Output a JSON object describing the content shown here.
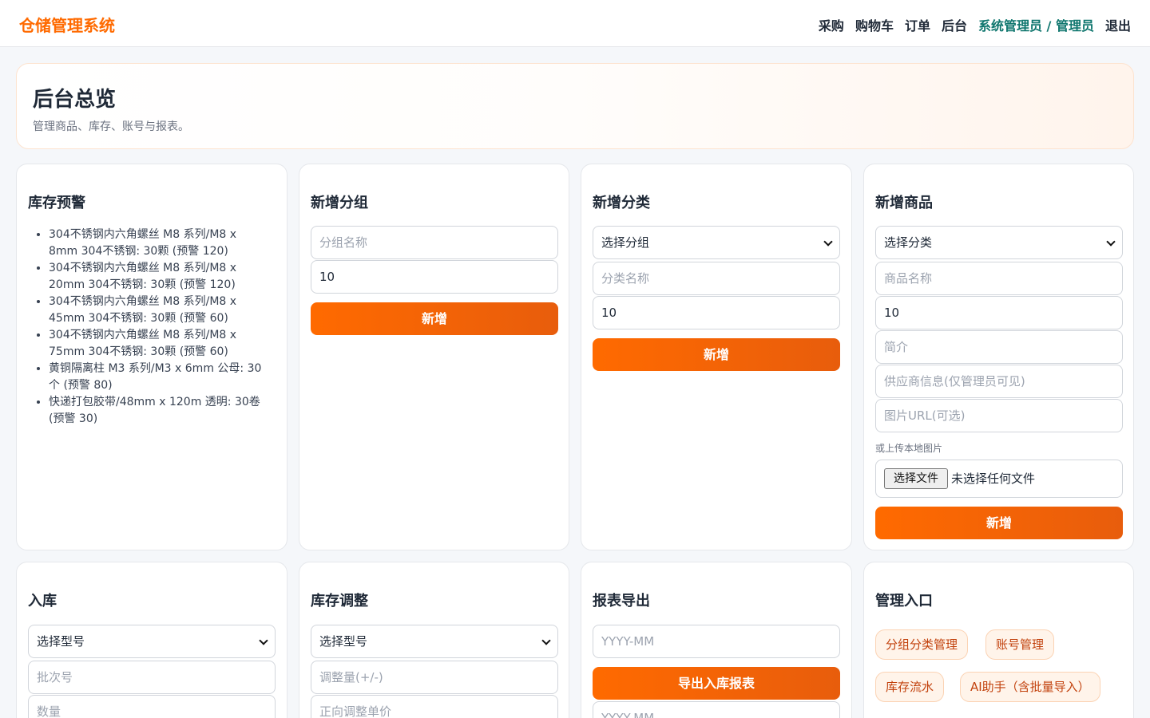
{
  "app": {
    "title": "仓储管理系统"
  },
  "nav": {
    "items": [
      "采购",
      "购物车",
      "订单",
      "后台"
    ],
    "role": "系统管理员 / 管理员",
    "logout": "退出"
  },
  "hero": {
    "title": "后台总览",
    "subtitle": "管理商品、库存、账号与报表。"
  },
  "stock_warning": {
    "title": "库存预警",
    "items": [
      "304不锈钢内六角螺丝 M8 系列/M8 x 8mm 304不锈钢: 30颗 (预警 120)",
      "304不锈钢内六角螺丝 M8 系列/M8 x 20mm 304不锈钢: 30颗 (预警 120)",
      "304不锈钢内六角螺丝 M8 系列/M8 x 45mm 304不锈钢: 30颗 (预警 60)",
      "304不锈钢内六角螺丝 M8 系列/M8 x 75mm 304不锈钢: 30颗 (预警 60)",
      "黄铜隔离柱 M3 系列/M3 x 6mm 公母: 30个 (预警 80)",
      "快递打包胶带/48mm x 120m 透明: 30卷 (预警 30)"
    ]
  },
  "add_group": {
    "title": "新增分组",
    "name_placeholder": "分组名称",
    "sort_value": "10",
    "submit": "新增"
  },
  "add_category": {
    "title": "新增分类",
    "group_select": "选择分组",
    "name_placeholder": "分类名称",
    "sort_value": "10",
    "submit": "新增"
  },
  "add_product": {
    "title": "新增商品",
    "category_select": "选择分类",
    "name_placeholder": "商品名称",
    "sort_value": "10",
    "intro_placeholder": "简介",
    "supplier_placeholder": "供应商信息(仅管理员可见)",
    "image_url_placeholder": "图片URL(可选)",
    "upload_label": "或上传本地图片",
    "file_button": "选择文件",
    "file_status": "未选择任何文件",
    "submit": "新增"
  },
  "stock_in": {
    "title": "入库",
    "model_select": "选择型号",
    "batch_placeholder": "批次号",
    "qty_placeholder": "数量"
  },
  "stock_adjust": {
    "title": "库存调整",
    "model_select": "选择型号",
    "delta_placeholder": "调整量(+/-)",
    "price_placeholder": "正向调整单价"
  },
  "report_export": {
    "title": "报表导出",
    "month_placeholder": "YYYY-MM",
    "export_in": "导出入库报表",
    "month_placeholder_2": "YYYY-MM"
  },
  "admin_entry": {
    "title": "管理入口",
    "links": [
      "分组分类管理",
      "账号管理",
      "库存流水",
      "AI助手（含批量导入）"
    ]
  }
}
